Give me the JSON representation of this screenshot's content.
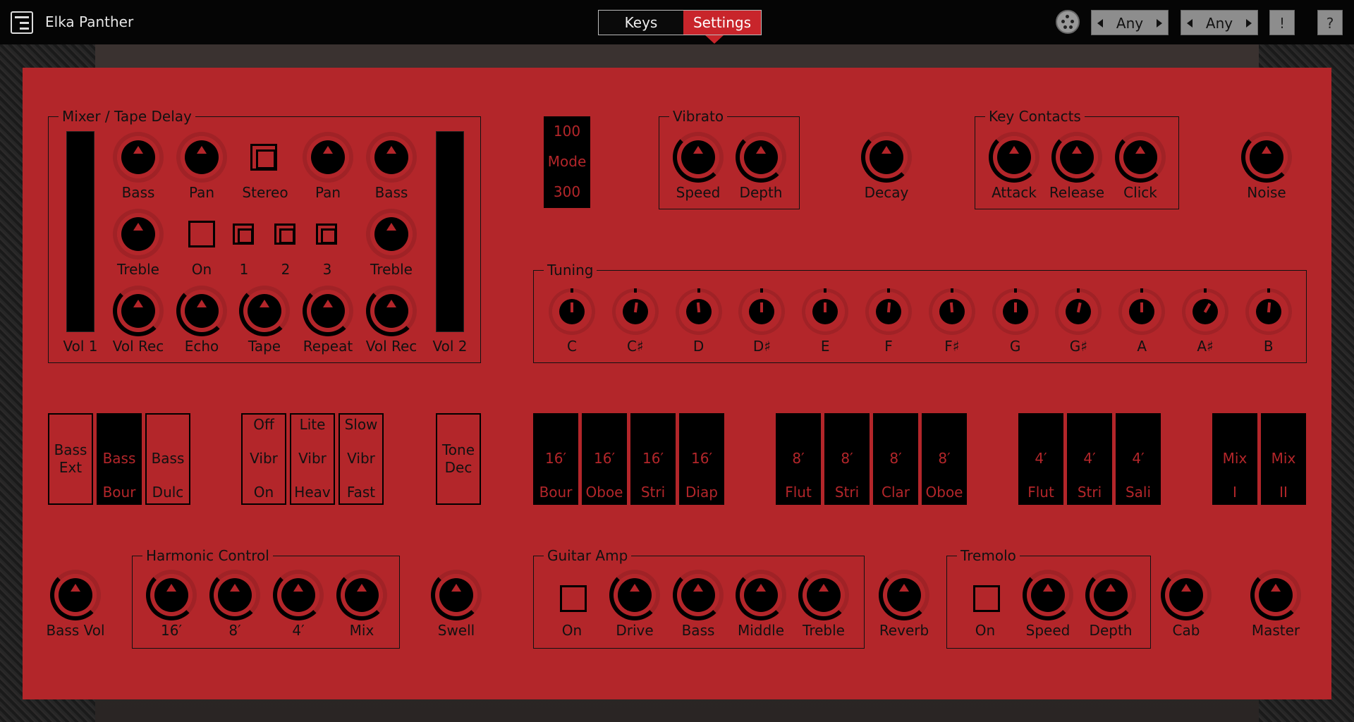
{
  "topbar": {
    "app_title": "Elka Panther",
    "tabs": [
      {
        "label": "Keys"
      },
      {
        "label": "Settings",
        "active": true
      }
    ],
    "selector1": "Any",
    "selector2": "Any",
    "info_label": "!",
    "help_label": "?"
  },
  "colors": {
    "panel": "#b3262a",
    "accent": "#c8252b",
    "dark": "#000000"
  },
  "mixer": {
    "title": "Mixer / Tape Delay",
    "row1": [
      "Bass",
      "Pan",
      "Stereo",
      "Pan",
      "Bass"
    ],
    "row2": [
      "Treble",
      "On",
      "1",
      "2",
      "3",
      "Treble"
    ],
    "row3": [
      "Vol 1",
      "Vol Rec",
      "Echo",
      "Tape",
      "Repeat",
      "Vol Rec",
      "Vol 2"
    ]
  },
  "mode": {
    "top": "100",
    "mid": "Mode",
    "bottom": "300"
  },
  "vibrato": {
    "title": "Vibrato",
    "knobs": [
      "Speed",
      "Depth"
    ]
  },
  "decay": {
    "label": "Decay"
  },
  "key_contacts": {
    "title": "Key Contacts",
    "knobs": [
      "Attack",
      "Release",
      "Click"
    ]
  },
  "noise": {
    "label": "Noise"
  },
  "tuning": {
    "title": "Tuning",
    "notes": [
      "C",
      "C♯",
      "D",
      "D♯",
      "E",
      "F",
      "F♯",
      "G",
      "G♯",
      "A",
      "A♯",
      "B"
    ]
  },
  "tabs_row": {
    "bass": [
      {
        "t1": "Bass",
        "t2": "Ext",
        "dark": false
      },
      {
        "t1": "Bass",
        "t2": "Bour",
        "dark": true
      },
      {
        "t1": "Bass",
        "t2": "Dulc",
        "dark": false
      }
    ],
    "vibr": [
      {
        "a": "Off",
        "b": "Vibr",
        "c": "On"
      },
      {
        "a": "Lite",
        "b": "Vibr",
        "c": "Heav"
      },
      {
        "a": "Slow",
        "b": "Vibr",
        "c": "Fast"
      }
    ],
    "tone": {
      "t1": "Tone",
      "t2": "Dec"
    },
    "sixteen": [
      {
        "f": "16′",
        "n": "Bour"
      },
      {
        "f": "16′",
        "n": "Oboe"
      },
      {
        "f": "16′",
        "n": "Stri"
      },
      {
        "f": "16′",
        "n": "Diap"
      }
    ],
    "eight": [
      {
        "f": "8′",
        "n": "Flut"
      },
      {
        "f": "8′",
        "n": "Stri"
      },
      {
        "f": "8′",
        "n": "Clar"
      },
      {
        "f": "8′",
        "n": "Oboe"
      }
    ],
    "four": [
      {
        "f": "4′",
        "n": "Flut"
      },
      {
        "f": "4′",
        "n": "Stri"
      },
      {
        "f": "4′",
        "n": "Sali"
      }
    ],
    "mix": [
      {
        "f": "Mix",
        "n": "I"
      },
      {
        "f": "Mix",
        "n": "II"
      }
    ]
  },
  "bottom": {
    "bass_vol": "Bass Vol",
    "harmonic": {
      "title": "Harmonic Control",
      "knobs": [
        "16′",
        "8′",
        "4′",
        "Mix"
      ]
    },
    "swell": "Swell",
    "guitar_amp": {
      "title": "Guitar Amp",
      "on": "On",
      "knobs": [
        "Drive",
        "Bass",
        "Middle",
        "Treble"
      ]
    },
    "reverb": "Reverb",
    "tremolo": {
      "title": "Tremolo",
      "on": "On",
      "knobs": [
        "Speed",
        "Depth"
      ]
    },
    "cab": "Cab",
    "master": "Master"
  }
}
